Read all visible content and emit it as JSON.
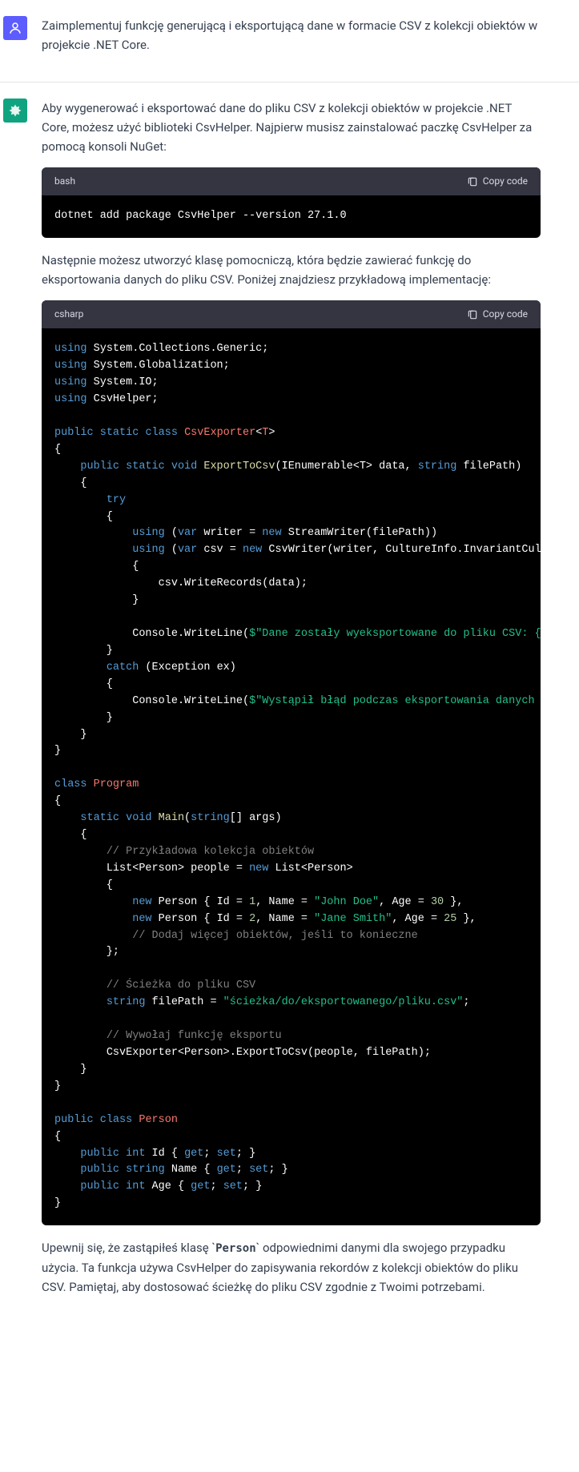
{
  "user": {
    "text": "Zaimplementuj funkcję generującą i eksportującą dane w formacie CSV z kolekcji obiektów w projekcie .NET Core."
  },
  "assistant": {
    "intro": "Aby wygenerować i eksportować dane do pliku CSV z kolekcji obiektów w projekcie .NET Core, możesz użyć biblioteki CsvHelper. Najpierw musisz zainstalować paczkę CsvHelper za pomocą konsoli NuGet:",
    "mid": "Następnie możesz utworzyć klasę pomocniczą, która będzie zawierać funkcję do eksportowania danych do pliku CSV. Poniżej znajdziesz przykładową implementację:",
    "outro_pre": "Upewnij się, że zastąpiłeś klasę ",
    "outro_code": "Person",
    "outro_post": " odpowiednimi danymi dla swojego przypadku użycia. Ta funkcja używa CsvHelper do zapisywania rekordów z kolekcji obiektów do pliku CSV. Pamiętaj, aby dostosować ścieżkę do pliku CSV zgodnie z Twoimi potrzebami."
  },
  "code1": {
    "lang": "bash",
    "copy": "Copy code",
    "body": "dotnet add package CsvHelper --version 27.1.0"
  },
  "code2": {
    "lang": "csharp",
    "copy": "Copy code",
    "t": {
      "using": "using",
      "pkg1": "System.Collections.Generic;",
      "pkg2": "System.Globalization;",
      "pkg3": "System.IO;",
      "pkg4": "CsvHelper;",
      "public": "public",
      "static": "static",
      "class": "class",
      "void": "void",
      "string": "string",
      "int": "int",
      "var": "var",
      "new": "new",
      "try": "try",
      "catch": "catch",
      "get": "get",
      "set": "set",
      "CsvExporter": "CsvExporter",
      "T": "T",
      "ExportToCsv": "ExportToCsv",
      "IEnumerable": "IEnumerable",
      "data": "data",
      "filePath": "filePath",
      "writer": "writer",
      "StreamWriter": "StreamWriter",
      "csv": "csv",
      "CsvWriter": "CsvWriter",
      "CultureInfo": "CultureInfo",
      "InvariantCulture": "InvariantCulture",
      "WriteRecords": "WriteRecords",
      "Console": "Console",
      "WriteLine": "WriteLine",
      "Exception": "Exception",
      "ex": "ex",
      "str_export": "\"Dane zostały wyeksportowane do pliku CSV: {filePath}\"",
      "str_error": "\"Wystąpił błąd podczas eksportowania danych do pliku CSV: {ex.Message}\"",
      "Program": "Program",
      "Main": "Main",
      "args": "args",
      "com_example": "// Przykładowa kolekcja obiektów",
      "List": "List",
      "Person": "Person",
      "people": "people",
      "Id": "Id",
      "Name": "Name",
      "Age": "Age",
      "john": "\"John Doe\"",
      "jane": "\"Jane Smith\"",
      "n1": "1",
      "n2": "2",
      "n30": "30",
      "n25": "25",
      "com_more": "// Dodaj więcej obiektów, jeśli to konieczne",
      "com_path": "// Ścieżka do pliku CSV",
      "str_path": "\"ścieżka/do/eksportowanego/pliku.csv\"",
      "com_invoke": "// Wywołaj funkcję eksportu"
    }
  }
}
